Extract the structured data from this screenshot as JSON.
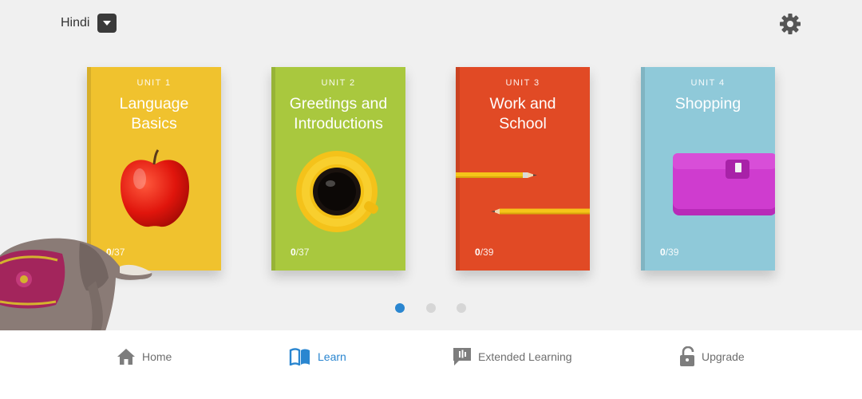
{
  "header": {
    "language": "Hindi",
    "caret_icon": "chevron-down-icon",
    "settings_icon": "gear-icon"
  },
  "units": [
    {
      "unit_label": "UNIT 1",
      "title_lines": [
        "Language",
        "Basics"
      ],
      "progress_done": "0",
      "progress_total": "/37",
      "color": "#f0c22e",
      "image": "apple"
    },
    {
      "unit_label": "UNIT 2",
      "title_lines": [
        "Greetings and",
        "Introductions"
      ],
      "progress_done": "0",
      "progress_total": "/37",
      "color": "#a9c83e",
      "image": "coffee-cup"
    },
    {
      "unit_label": "UNIT 3",
      "title_lines": [
        "Work and",
        "School"
      ],
      "progress_done": "0",
      "progress_total": "/39",
      "color": "#e14a25",
      "image": "pencils"
    },
    {
      "unit_label": "UNIT 4",
      "title_lines": [
        "Shopping"
      ],
      "progress_done": "0",
      "progress_total": "/39",
      "color": "#8fc9d9",
      "image": "wallet"
    }
  ],
  "pager": {
    "pages": 3,
    "active_index": 0
  },
  "bottom_nav": [
    {
      "label": "Home",
      "icon": "home-icon",
      "active": false
    },
    {
      "label": "Learn",
      "icon": "book-icon",
      "active": true
    },
    {
      "label": "Extended Learning",
      "icon": "extended-learning-icon",
      "active": false
    },
    {
      "label": "Upgrade",
      "icon": "lock-icon",
      "active": false
    }
  ],
  "colors": {
    "background": "#f0f0f0",
    "accent": "#2a86d0",
    "nav_inactive": "#6e6e6e"
  }
}
